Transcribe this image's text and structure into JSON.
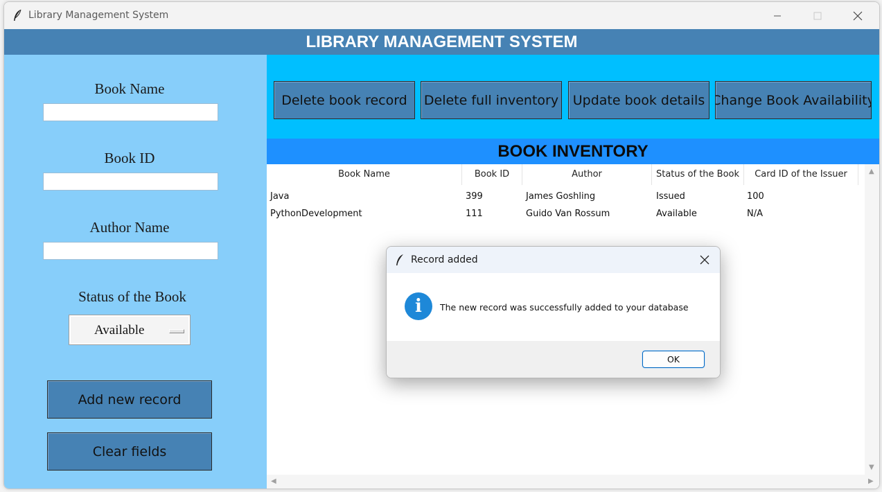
{
  "window": {
    "title": "Library Management System",
    "icon": "feather-icon"
  },
  "header": {
    "title": "LIBRARY MANAGEMENT SYSTEM"
  },
  "form": {
    "book_name_label": "Book Name",
    "book_name_value": "",
    "book_id_label": "Book ID",
    "book_id_value": "",
    "author_label": "Author Name",
    "author_value": "",
    "status_label": "Status of the Book",
    "status_selected": "Available",
    "add_button": "Add new record",
    "clear_button": "Clear fields"
  },
  "toolbar": {
    "delete_record": "Delete book record",
    "delete_inventory": "Delete full inventory",
    "update_details": "Update book details",
    "change_availability": "Change Book Availability"
  },
  "inventory": {
    "title": "BOOK INVENTORY",
    "columns": [
      "Book Name",
      "Book ID",
      "Author",
      "Status of the Book",
      "Card ID of the Issuer"
    ],
    "rows": [
      [
        "Java",
        "399",
        "James Goshling",
        "Issued",
        "100"
      ],
      [
        "PythonDevelopment",
        "111",
        "Guido Van Rossum",
        "Available",
        "N/A"
      ]
    ]
  },
  "dialog": {
    "title": "Record added",
    "message": "The new record was successfully added to your database",
    "ok_label": "OK",
    "icon": "info-icon",
    "icon_glyph": "i"
  },
  "colors": {
    "header_bg": "#4682b4",
    "left_panel_bg": "#87cefa",
    "top_panel_bg": "#00bfff",
    "inventory_header_bg": "#1e90ff",
    "button_bg": "#4682b4"
  }
}
